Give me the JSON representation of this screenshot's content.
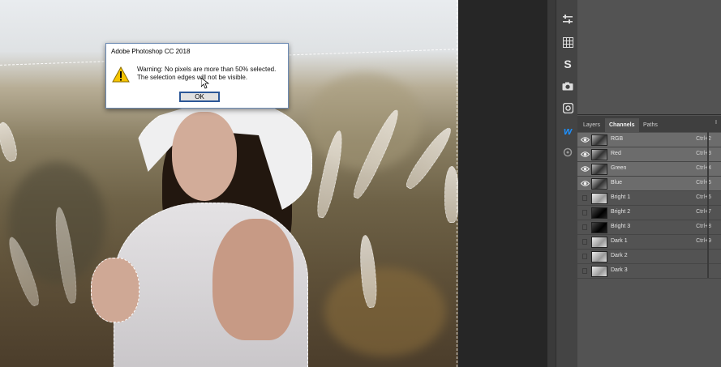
{
  "dialog": {
    "title": "Adobe Photoshop CC 2018",
    "message_line1": "Warning: No pixels are more than 50% selected.",
    "message_line2": "The selection edges will not be visible.",
    "ok_label": "OK"
  },
  "dock": {
    "icons": [
      "adjustments-icon",
      "grid-icon",
      "s-plugin-icon",
      "camera-icon",
      "instagram-icon",
      "w-plugin-icon",
      "puzzle-icon"
    ],
    "s_label": "S",
    "w_label": "w"
  },
  "panel": {
    "tabs": [
      {
        "label": "Layers"
      },
      {
        "label": "Channels"
      },
      {
        "label": "Paths"
      }
    ],
    "more_label": "I",
    "channels": [
      {
        "name": "RGB",
        "shortcut": "Ctrl+2",
        "visible": true,
        "selected": true
      },
      {
        "name": "Red",
        "shortcut": "Ctrl+3",
        "visible": true,
        "selected": true
      },
      {
        "name": "Green",
        "shortcut": "Ctrl+4",
        "visible": true,
        "selected": true
      },
      {
        "name": "Blue",
        "shortcut": "Ctrl+5",
        "visible": true,
        "selected": true
      },
      {
        "name": "Bright 1",
        "shortcut": "Ctrl+6",
        "visible": false,
        "selected": false
      },
      {
        "name": "Bright 2",
        "shortcut": "Ctrl+7",
        "visible": false,
        "selected": false
      },
      {
        "name": "Bright 3",
        "shortcut": "Ctrl+8",
        "visible": false,
        "selected": false
      },
      {
        "name": "Dark 1",
        "shortcut": "Ctrl+9",
        "visible": false,
        "selected": false
      },
      {
        "name": "Dark 2",
        "shortcut": "",
        "visible": false,
        "selected": false
      },
      {
        "name": "Dark 3",
        "shortcut": "",
        "visible": false,
        "selected": false
      }
    ]
  },
  "colors": {
    "panel_bg": "#535353",
    "selected_row": "#6c6c6c",
    "dock_bg": "#444444",
    "button_border": "#2b5797",
    "warning_yellow": "#f5c400",
    "w_plugin_blue": "#1e90ff"
  }
}
